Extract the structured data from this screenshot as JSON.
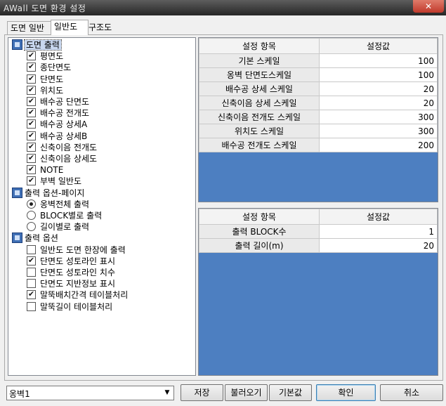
{
  "window": {
    "title": "AWall 도면 환경 설정",
    "close_glyph": "✕"
  },
  "tabs": [
    {
      "label": "도면 일반",
      "active": false
    },
    {
      "label": "일반도",
      "active": true
    },
    {
      "label": "구조도",
      "active": false
    }
  ],
  "tree": {
    "groups": [
      {
        "label": "도면 출력",
        "icon": "group-icon",
        "items": [
          {
            "label": "평면도",
            "checked": true
          },
          {
            "label": "종단면도",
            "checked": true
          },
          {
            "label": "단면도",
            "checked": true
          },
          {
            "label": "위치도",
            "checked": true
          },
          {
            "label": "배수공 단면도",
            "checked": true
          },
          {
            "label": "배수공 전개도",
            "checked": true
          },
          {
            "label": "배수공 상세A",
            "checked": true
          },
          {
            "label": "배수공 상세B",
            "checked": true
          },
          {
            "label": "신축이음 전개도",
            "checked": true
          },
          {
            "label": "신축이음 상세도",
            "checked": true
          },
          {
            "label": "NOTE",
            "checked": true
          },
          {
            "label": "부벽 일반도",
            "checked": true
          }
        ]
      },
      {
        "label": "출력 옵션-페이지",
        "icon": "group-icon",
        "radios": [
          {
            "label": "옹벽전체 출력",
            "selected": true
          },
          {
            "label": "BLOCK별로 출력",
            "selected": false
          },
          {
            "label": "길이별로 출력",
            "selected": false
          }
        ]
      },
      {
        "label": "출력 옵션",
        "icon": "group-icon",
        "items": [
          {
            "label": "일반도 도면 한장에 출력",
            "checked": false
          },
          {
            "label": "단면도 성토라인 표시",
            "checked": true
          },
          {
            "label": "단면도 성토라인 치수",
            "checked": false
          },
          {
            "label": "단면도 지반정보 표시",
            "checked": false
          },
          {
            "label": "말뚝배치간격 테이블처리",
            "checked": true
          },
          {
            "label": "말뚝길이 테이블처리",
            "checked": false
          }
        ]
      }
    ]
  },
  "scale_grid": {
    "headers": [
      "설정 항목",
      "설정값"
    ],
    "rows": [
      {
        "name": "기본 스케일",
        "value": "100"
      },
      {
        "name": "옹벽 단면도스케일",
        "value": "100"
      },
      {
        "name": "배수공 상세 스케일",
        "value": "20"
      },
      {
        "name": "신축이음 상세 스케일",
        "value": "20"
      },
      {
        "name": "신축이음 전개도 스케일",
        "value": "300"
      },
      {
        "name": "위치도 스케일",
        "value": "300"
      },
      {
        "name": "배수공 전개도 스케일",
        "value": "200"
      }
    ]
  },
  "output_grid": {
    "headers": [
      "설정 항목",
      "설정값"
    ],
    "rows": [
      {
        "name": "출력 BLOCK수",
        "value": "1"
      },
      {
        "name": "출력 길이(m)",
        "value": "20"
      }
    ]
  },
  "footer": {
    "combo_value": "옹벽1",
    "buttons": {
      "save": "저장",
      "load": "불러오기",
      "default": "기본값",
      "ok": "확인",
      "cancel": "취소"
    }
  },
  "colors": {
    "grid_empty": "#4d7fc1",
    "titlebar": "#3a3a3a",
    "close": "#c0392b"
  }
}
